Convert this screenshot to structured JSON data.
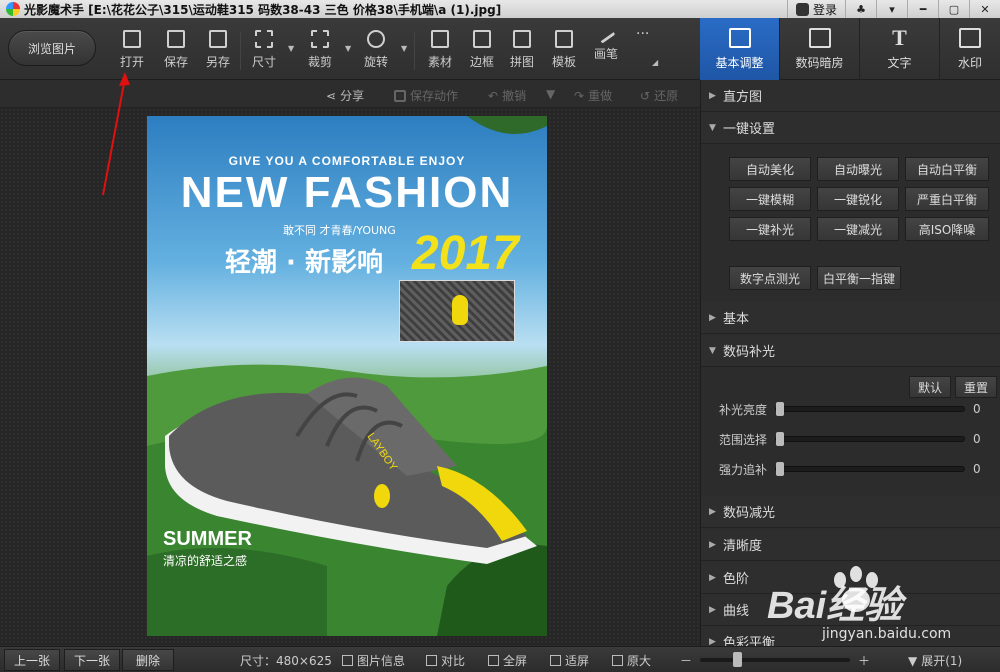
{
  "titlebar": {
    "title": "光影魔术手 [E:\\花花公子\\315\\运动鞋315 码数38-43 三色 价格38\\手机端\\a (1).jpg]",
    "login": "登录"
  },
  "toolbar": {
    "browse": "浏览图片",
    "tools": [
      {
        "label": "打开"
      },
      {
        "label": "保存"
      },
      {
        "label": "另存"
      },
      {
        "label": "尺寸"
      },
      {
        "label": "裁剪"
      },
      {
        "label": "旋转"
      },
      {
        "label": "素材"
      },
      {
        "label": "边框"
      },
      {
        "label": "拼图"
      },
      {
        "label": "模板"
      },
      {
        "label": "画笔"
      }
    ],
    "more": "···"
  },
  "subbar": {
    "share": "分享",
    "save_action": "保存动作",
    "undo": "撤销",
    "redo": "重做",
    "restore": "还原"
  },
  "poster": {
    "line1": "GIVE YOU A COMFORTABLE ENJOY",
    "line2": "NEW FASHION",
    "line3": "敢不同 才青春/YOUNG",
    "line4": "轻潮 · 新影响",
    "year": "2017",
    "summer": "SUMMER",
    "summer_sub": "清凉的舒适之感",
    "brand_text": "LAYBOY"
  },
  "right_tabs": [
    {
      "label": "基本调整"
    },
    {
      "label": "数码暗房"
    },
    {
      "label": "文字"
    },
    {
      "label": "水印"
    }
  ],
  "right_panel": {
    "histogram": "直方图",
    "one_click": "一键设置",
    "buttons": [
      "自动美化",
      "自动曝光",
      "自动白平衡",
      "一键模糊",
      "一键锐化",
      "严重白平衡",
      "一键补光",
      "一键减光",
      "高ISO降噪"
    ],
    "buttons_row2": [
      "数字点测光",
      "白平衡一指键"
    ],
    "basic": "基本",
    "fill_light": "数码补光",
    "default": "默认",
    "reset": "重置",
    "sliders": [
      {
        "label": "补光亮度",
        "value": "0"
      },
      {
        "label": "范围选择",
        "value": "0"
      },
      {
        "label": "强力追补",
        "value": "0"
      }
    ],
    "reduce_light": "数码减光",
    "sharpness": "清晰度",
    "levels": "色阶",
    "curves": "曲线",
    "color_balance": "色彩平衡"
  },
  "statusbar": {
    "prev": "上一张",
    "next": "下一张",
    "delete": "删除",
    "size": "尺寸：480×625",
    "info": "图片信息",
    "compare": "对比",
    "fullscreen": "全屏",
    "fit": "适屏",
    "original": "原大",
    "expand": "展开(1)"
  },
  "watermark": {
    "text": "Bai经验",
    "url": "jingyan.baidu.com"
  }
}
